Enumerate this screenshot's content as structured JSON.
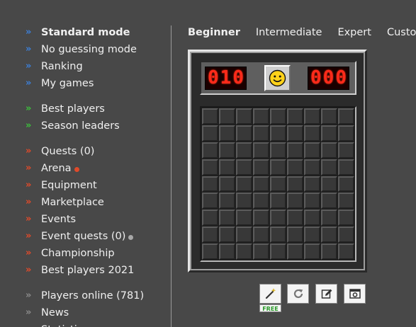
{
  "sidebar": {
    "group1": [
      {
        "label": "Standard mode",
        "bullet": "»",
        "bold": true
      },
      {
        "label": "No guessing mode",
        "bullet": "»",
        "bold": false
      },
      {
        "label": "Ranking",
        "bullet": "»",
        "bold": false
      },
      {
        "label": "My games",
        "bullet": "»",
        "bold": false
      }
    ],
    "group2": [
      {
        "label": "Best players",
        "bullet": "»"
      },
      {
        "label": "Season leaders",
        "bullet": "»"
      }
    ],
    "group3": [
      {
        "label": "Quests (0)",
        "bullet": "»"
      },
      {
        "label": "Arena",
        "bullet": "»",
        "dot_color": "#e04a2a"
      },
      {
        "label": "Equipment",
        "bullet": "»"
      },
      {
        "label": "Marketplace",
        "bullet": "»"
      },
      {
        "label": "Events",
        "bullet": "»"
      },
      {
        "label": "Event quests (0)",
        "bullet": "»",
        "dot_color": "#a8a8a8"
      },
      {
        "label": "Championship",
        "bullet": "»"
      },
      {
        "label": "Best players 2021",
        "bullet": "»"
      }
    ],
    "group4": [
      {
        "label": "Players online (781)",
        "bullet": "»"
      },
      {
        "label": "News",
        "bullet": "»"
      },
      {
        "label": "Statistics",
        "bullet": "»"
      }
    ],
    "colors": {
      "group1_bullet": "#3c7fd8",
      "group2_bullet": "#3cbf3c",
      "group3_bullet": "#e04a2a",
      "group4_bullet": "#8a8a8a"
    }
  },
  "tabs": [
    {
      "label": "Beginner",
      "active": true
    },
    {
      "label": "Intermediate",
      "active": false
    },
    {
      "label": "Expert",
      "active": false
    },
    {
      "label": "Custom",
      "active": false
    }
  ],
  "game": {
    "mines_counter": "010",
    "timer": "000",
    "face": "smiley",
    "rows": 9,
    "cols": 9
  },
  "tools": {
    "hint_icon": "magic-wand-icon",
    "hint_badge": "FREE",
    "restart_icon": "restart-icon",
    "edit_icon": "edit-icon",
    "screenshot_icon": "screenshot-icon"
  },
  "theme": {
    "background": "#484848",
    "text": "#f0f0f0",
    "digit": "#ff2a1a",
    "badge": "#2a9a2a"
  }
}
